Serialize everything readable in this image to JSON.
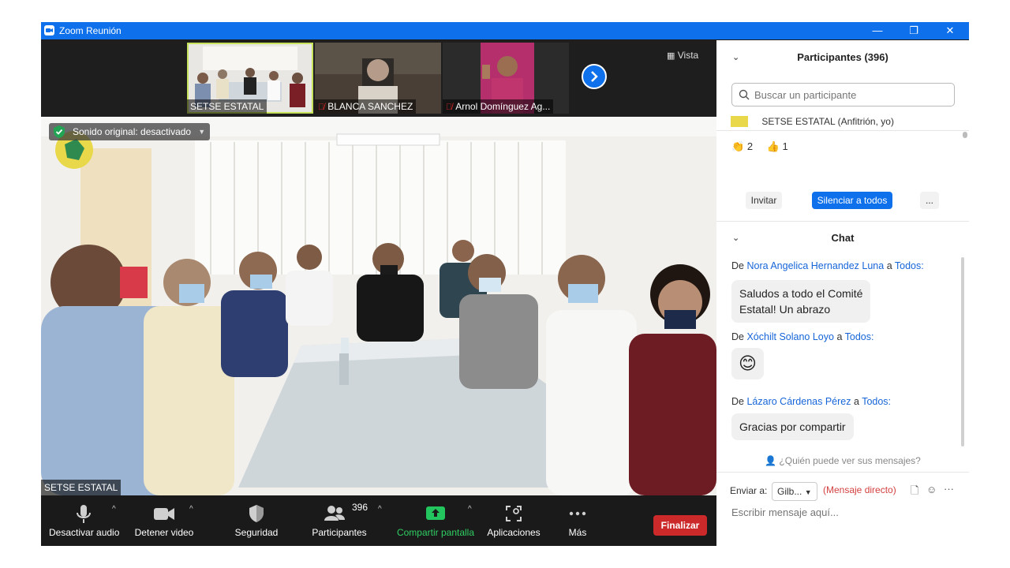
{
  "window": {
    "title": "Zoom Reunión",
    "minimize": "—",
    "restore": "❐",
    "close": "✕"
  },
  "strip": {
    "view_label": "Vista",
    "thumbnails": [
      {
        "name": "SETSE ESTATAL",
        "muted": false
      },
      {
        "name": "BLANCA SANCHEZ",
        "muted": true
      },
      {
        "name": "Arnol Domínguez Ag...",
        "muted": true
      }
    ]
  },
  "main_video": {
    "sound_banner": "Sonido original: desactivado",
    "speaker_label": "SETSE ESTATAL"
  },
  "toolbar": {
    "audio_label": "Desactivar audio",
    "video_label": "Detener video",
    "security_label": "Seguridad",
    "participants_label": "Participantes",
    "participants_count": "396",
    "share_label": "Compartir pantalla",
    "apps_label": "Aplicaciones",
    "more_label": "Más",
    "end_label": "Finalizar"
  },
  "participants_panel": {
    "title": "Participantes (396)",
    "search_placeholder": "Buscar un participante",
    "first_participant": "SETSE ESTATAL (Anfitrión, yo)",
    "reactions": [
      {
        "emoji": "👏",
        "count": "2"
      },
      {
        "emoji": "👍",
        "count": "1"
      }
    ],
    "invite_label": "Invitar",
    "mute_all_label": "Silenciar a todos",
    "more_label": "..."
  },
  "chat": {
    "title": "Chat",
    "from_word": "De",
    "to_word": "a",
    "messages": [
      {
        "sender": "Nora Angelica Hernandez Luna",
        "to": "Todos:",
        "text_line1": "Saludos a todo el Comité",
        "text_line2": "Estatal! Un abrazo"
      },
      {
        "sender": "Xóchilt Solano Loyo",
        "to": "Todos:",
        "text": "😊"
      },
      {
        "sender": "Lázaro Cárdenas Pérez",
        "to": "Todos:",
        "text": "Gracias por compartir"
      }
    ],
    "who_sees": "¿Quién puede ver sus mensajes?",
    "send_to_label": "Enviar a:",
    "send_to_value": "Gilb...",
    "direct_message": "(Mensaje directo)",
    "compose_placeholder": "Escribir mensaje aquí..."
  },
  "colors": {
    "accent": "#0e71eb",
    "end": "#cc2a2a",
    "share": "#22c55e",
    "link": "#1665d8"
  }
}
